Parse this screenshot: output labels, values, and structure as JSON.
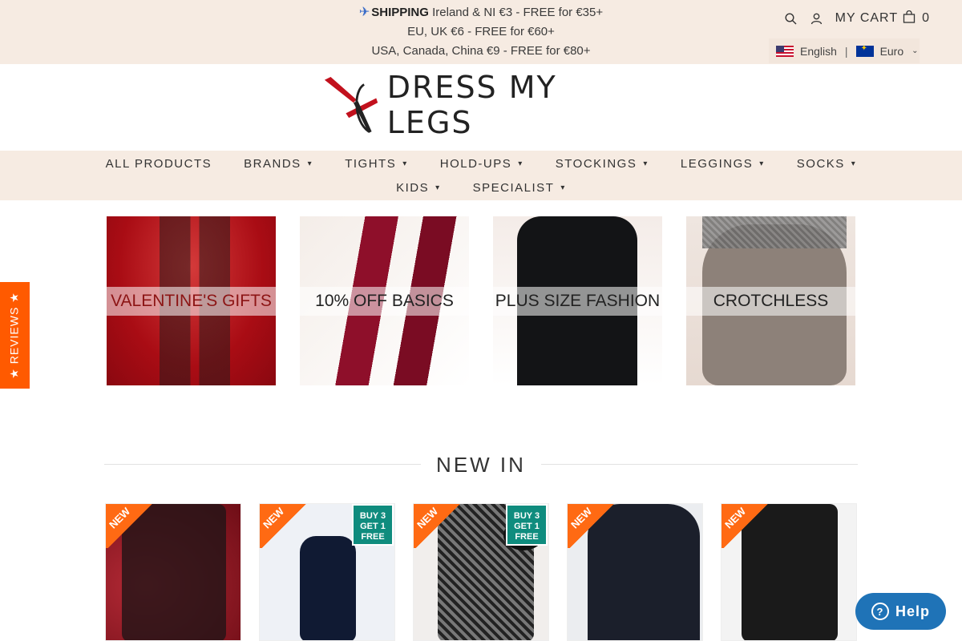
{
  "announcement": {
    "icon": "airplane-icon",
    "label": "SHIPPING",
    "line1": "Ireland & NI €3 - FREE for €35+",
    "line2": "EU, UK €6 - FREE for €60+",
    "line3": "USA, Canada, China €9 - FREE for €80+"
  },
  "header": {
    "cart_label": "MY CART",
    "cart_count": "0",
    "language": "English",
    "currency": "Euro"
  },
  "brand": {
    "name": "DRESS MY LEGS"
  },
  "nav": {
    "row1": [
      {
        "label": "ALL PRODUCTS",
        "dropdown": false
      },
      {
        "label": "BRANDS",
        "dropdown": true
      },
      {
        "label": "TIGHTS",
        "dropdown": true
      },
      {
        "label": "HOLD-UPS",
        "dropdown": true
      },
      {
        "label": "STOCKINGS",
        "dropdown": true
      },
      {
        "label": "LEGGINGS",
        "dropdown": true
      },
      {
        "label": "SOCKS",
        "dropdown": true
      }
    ],
    "row2": [
      {
        "label": "KIDS",
        "dropdown": true
      },
      {
        "label": "SPECIALIST",
        "dropdown": true
      }
    ]
  },
  "tiles": [
    {
      "label": "VALENTINE'S GIFTS"
    },
    {
      "label": "10% OFF BASICS"
    },
    {
      "label": "PLUS SIZE FASHION"
    },
    {
      "label": "CROTCHLESS"
    }
  ],
  "reviews_tab": {
    "label": "★ REVIEWS ★"
  },
  "new_in": {
    "title": "NEW IN",
    "badge": "NEW",
    "promo_line1": "BUY 3",
    "promo_line2": "GET 1",
    "promo_line3": "FREE"
  },
  "help": {
    "label": "Help"
  },
  "colors": {
    "announcement_bg": "#f6ebe2",
    "reviews_tab": "#ff5a00",
    "help_button": "#1f73b7",
    "new_badge": "#ff6a13",
    "promo_badge": "#0f8c7e"
  }
}
